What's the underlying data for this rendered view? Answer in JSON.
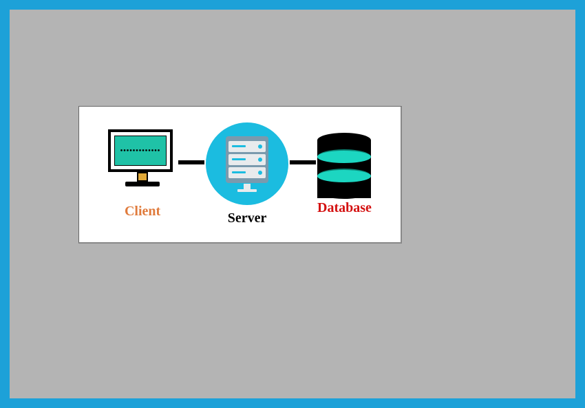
{
  "diagram": {
    "nodes": {
      "client": {
        "label": "Client",
        "color": "#e07b3c"
      },
      "server": {
        "label": "Server",
        "color": "#000000"
      },
      "database": {
        "label": "Database",
        "color": "#d41111"
      }
    }
  }
}
